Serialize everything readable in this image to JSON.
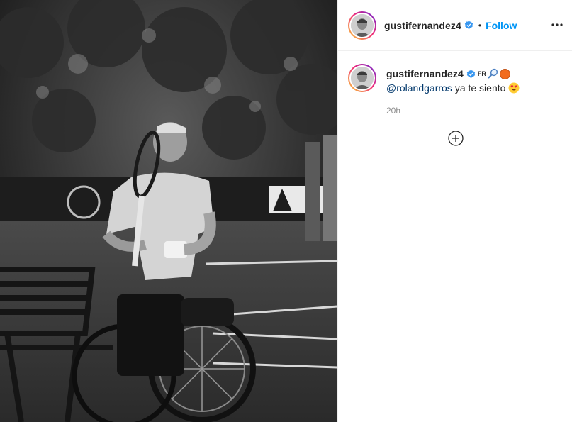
{
  "post": {
    "photo_alt": "",
    "header": {
      "username": "gustifernandez4",
      "separator": "•",
      "follow_label": "Follow"
    },
    "caption": {
      "username": "gustifernandez4",
      "flair": "FR",
      "mention": "@rolandgarros",
      "text": "ya te siento",
      "timestamp": "20h"
    },
    "icons": {
      "verified": "verified-badge-icon",
      "more": "more-options-icon",
      "load_more": "load-more-comments-icon",
      "racket": "tennis-racket-emoji",
      "ball": "orange-ball-emoji",
      "heart_eyes": "heart-eyes-emoji"
    },
    "colors": {
      "accent": "#0095f6",
      "mention": "#00376b",
      "verified": "#3897f0",
      "muted": "#8e8e8e"
    }
  }
}
